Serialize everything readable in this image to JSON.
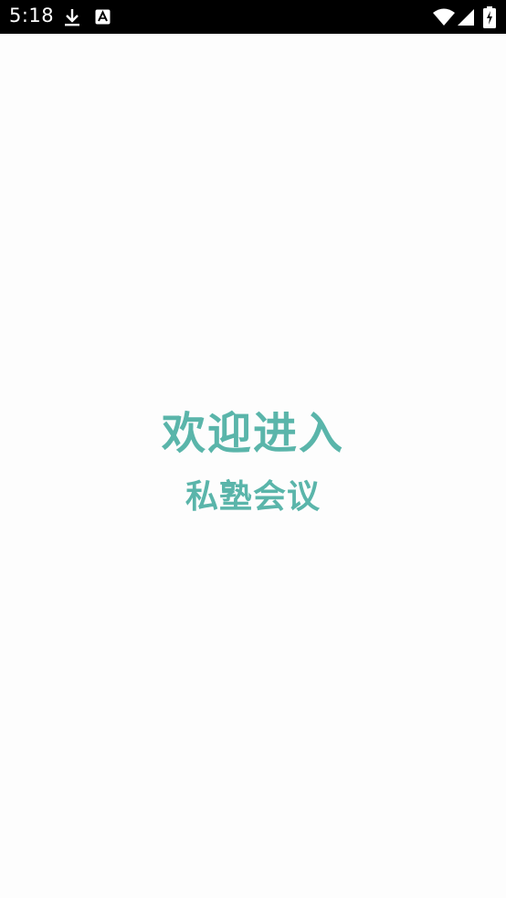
{
  "status_bar": {
    "time": "5:18",
    "icons": [
      "download-icon",
      "a-icon",
      "wifi-icon",
      "signal-icon",
      "battery-icon"
    ]
  },
  "splash": {
    "welcome": "欢迎进入",
    "app_name": "私塾会议"
  },
  "colors": {
    "accent": "#5ab5aa",
    "background": "#fdfdfd",
    "status_bar": "#000000"
  }
}
